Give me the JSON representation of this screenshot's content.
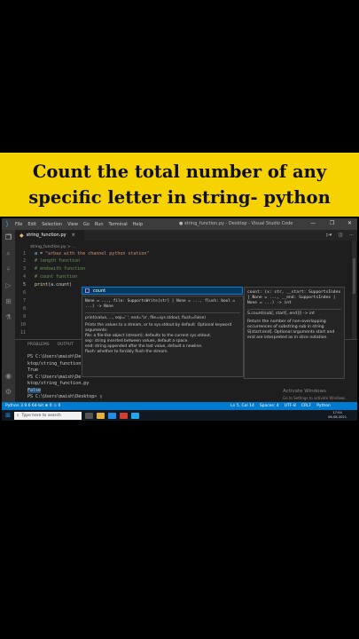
{
  "banner": {
    "line1": "Count the total number of any",
    "line2": "specific letter in string- python"
  },
  "vscode": {
    "menu": [
      "File",
      "Edit",
      "Selection",
      "View",
      "Go",
      "Run",
      "Terminal",
      "Help"
    ],
    "window_title": "● string_function.py - Desktop - Visual Studio Code",
    "tab": {
      "filename": "string_function.py",
      "close": "×"
    },
    "breadcrumb": "string_function.py > ...",
    "code_lines": [
      {
        "n": "1",
        "parts": [
          [
            "var",
            "a"
          ],
          [
            "op",
            " = "
          ],
          [
            "str",
            "\"arbaz with the channel python station\""
          ]
        ]
      },
      {
        "n": "2",
        "parts": [
          [
            "cmt",
            "# length function"
          ]
        ]
      },
      {
        "n": "3",
        "parts": [
          [
            "cmt",
            "# endswith function"
          ]
        ]
      },
      {
        "n": "4",
        "parts": [
          [
            "cmt",
            "# count function"
          ]
        ]
      },
      {
        "n": "5",
        "parts": [
          [
            "fn",
            "print"
          ],
          [
            "op",
            "("
          ],
          [
            "var",
            "a"
          ],
          [
            "op",
            ".count"
          ],
          [
            "op",
            ")"
          ]
        ]
      },
      {
        "n": "6",
        "parts": []
      },
      {
        "n": "7",
        "parts": []
      },
      {
        "n": "8",
        "parts": []
      },
      {
        "n": "9",
        "parts": []
      },
      {
        "n": "10",
        "parts": []
      },
      {
        "n": "11",
        "parts": []
      }
    ],
    "suggestion": "count",
    "signature_popup": {
      "sig": "None = ..., file: SupportsWrite[str] | None = ..., flush: bool = ...) -> None",
      "call": "print(value, ..., sep=' ', end='\\n', file=sys.stdout, flush=False)",
      "doc": [
        "Prints the values to a stream, or to sys.stdout by default. Optional keyword arguments:",
        "file: a file-like object (stream); defaults to the current sys.stdout.",
        "sep: string inserted between values, default a space.",
        "end: string appended after the last value, default a newline.",
        "flush: whether to forcibly flush the stream."
      ]
    },
    "doc_popup": {
      "sig": "count: (x: str, __start: SupportsIndex | None = ..., __end: SupportsIndex | None = ...) -> int",
      "call": "S.count(sub[, start[, end]]) -> int",
      "doc": "Return the number of non-overlapping occurrences of substring sub in string S[start:end]. Optional arguments start and end are interpreted as in slice notation."
    },
    "panel_tabs": [
      "PROBLEMS",
      "OUTPUT"
    ],
    "terminal_lines": [
      {
        "text": "PS C:\\Users\\maish\\De",
        "sel": false
      },
      {
        "text": "ktop/string_function",
        "sel": false
      },
      {
        "text": "True",
        "sel": false
      },
      {
        "text": "PS C:\\Users\\maish\\De",
        "sel": false
      },
      {
        "text": "ktop/string_function.py",
        "sel": false
      },
      {
        "text": "False",
        "sel": true
      },
      {
        "text": "PS C:\\Users\\maish\\Desktop> ▯",
        "sel": false
      }
    ],
    "watermark": {
      "title": "Activate Windows",
      "sub": "Go to Settings to activate Windows."
    },
    "status_left": "Python 3.9.6 64-bit  ⊗ 0 ⚠ 0",
    "status_right": [
      "Ln 5, Col 14",
      "Spaces: 4",
      "UTF-8",
      "CRLF",
      "Python"
    ],
    "taskbar_search": "Type here to search",
    "clock": {
      "time": "17:54",
      "date": "06-08-2021"
    }
  },
  "colors": {
    "banner_bg": "#f6d200",
    "status_bg": "#007acc"
  }
}
